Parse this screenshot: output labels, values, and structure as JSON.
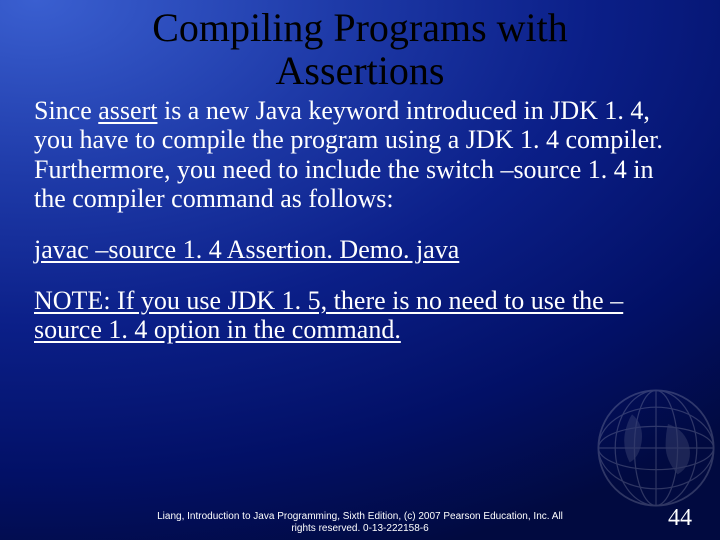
{
  "title": {
    "line1": "Compiling Programs with",
    "line2": "Assertions"
  },
  "para1": {
    "t1": "Since ",
    "assert_word": "assert",
    "t2": " is a new Java keyword introduced in JDK 1. 4, you have to compile the program using a JDK 1. 4 compiler. Furthermore, you need to include the switch –source 1. 4 in the compiler command as follows:"
  },
  "command_line": "javac –source 1. 4 Assertion. Demo. java",
  "para3": "NOTE: If you use JDK 1. 5, there is no need to use the –source 1. 4 option in the command.",
  "footer": {
    "line1": "Liang, Introduction to Java Programming, Sixth Edition, (c) 2007 Pearson Education, Inc. All",
    "line2": "rights reserved. 0-13-222158-6"
  },
  "page_number": "44"
}
